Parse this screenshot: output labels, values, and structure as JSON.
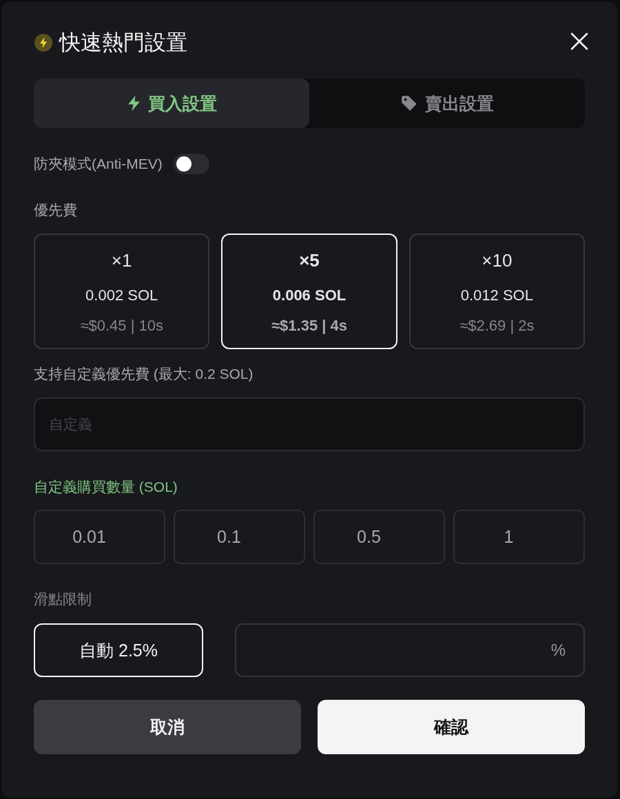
{
  "dialog": {
    "title": "快速熱門設置"
  },
  "tabs": [
    {
      "label": "買入設置",
      "selected": true,
      "kind": "buy"
    },
    {
      "label": "賣出設置",
      "selected": false,
      "kind": "sell"
    }
  ],
  "anti_mev": {
    "label": "防夾模式(Anti-MEV)",
    "on": false
  },
  "priority_fee": {
    "label": "優先費",
    "options": [
      {
        "multiplier": "×1",
        "amount": "0.002 SOL",
        "estimate": "≈$0.45 | 10s",
        "selected": false
      },
      {
        "multiplier": "×5",
        "amount": "0.006 SOL",
        "estimate": "≈$1.35 | 4s",
        "selected": true
      },
      {
        "multiplier": "×10",
        "amount": "0.012 SOL",
        "estimate": "≈$2.69 | 2s",
        "selected": false
      }
    ],
    "custom_label": "支持自定義優先費 (最大: 0.2 SOL)",
    "custom_field": {
      "placeholder": "自定義"
    }
  },
  "buy_amount": {
    "label": "自定義購買數量 (SOL)",
    "options": [
      "0.01",
      "0.1",
      "0.5",
      "1"
    ]
  },
  "slippage": {
    "label": "滑點限制",
    "auto": {
      "label": "自動 2.5%",
      "selected": true
    },
    "custom_field": {
      "unit": "%"
    }
  },
  "buttons": [
    {
      "label": "取消",
      "kind": "cancel"
    },
    {
      "label": "確認",
      "kind": "confirm"
    }
  ]
}
